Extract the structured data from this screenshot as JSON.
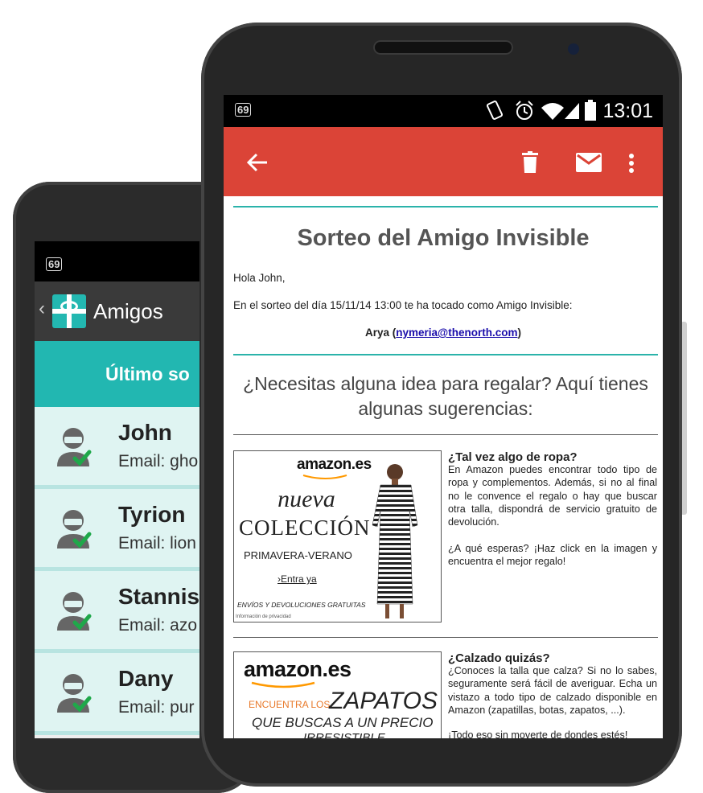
{
  "back_app": {
    "status_badge": "69",
    "title": "Amigos",
    "subtitle": "Último so",
    "contacts": [
      {
        "name": "John",
        "email": "Email: gho"
      },
      {
        "name": "Tyrion",
        "email": "Email: lion"
      },
      {
        "name": "Stannis",
        "email": "Email: azo"
      },
      {
        "name": "Dany",
        "email": "Email: pur"
      }
    ]
  },
  "front_app": {
    "status_badge": "69",
    "time": "13:01",
    "email": {
      "title": "Sorteo del Amigo Invisible",
      "greeting": "Hola John,",
      "intro": "En el sorteo del día 15/11/14 13:00 te ha tocado como Amigo Invisible:",
      "friend_name": "Arya",
      "friend_email": "nymeria@thenorth.com",
      "ideas_heading": "¿Necesitas alguna idea para regalar? Aquí tienes algunas sugerencias:",
      "suggestions": [
        {
          "title": "¿Tal vez algo de ropa?",
          "text": "En Amazon puedes encontrar todo tipo de ropa y complementos. Además, si no al final no le convence el regalo o hay que buscar otra talla, dispondrá de servicio gratuito de devolución.",
          "cta": "¿A qué esperas? ¡Haz click en la imagen y encuentra el mejor regalo!",
          "ad": {
            "brand": "amazon.es",
            "line1": "nueva",
            "line2": "COLECCIÓN",
            "line3": "PRIMAVERA-VERANO",
            "link": "›Entra ya",
            "footer": "ENVÍOS Y DEVOLUCIONES GRATUITAS",
            "privacy": "Información de privacidad"
          }
        },
        {
          "title": "¿Calzado quizás?",
          "text": "¿Conoces la talla que calza? Si no lo sabes, seguramente será fácil de averiguar. Echa un vistazo a todo tipo de calzado disponible en Amazon (zapatillas, botas, zapatos, ...).",
          "cta": "¡Todo eso sin moverte de dondes estés!",
          "ad": {
            "brand": "amazon.es",
            "line1": "ENCUENTRA LOS",
            "line2": "ZAPATOS",
            "line3": "QUE BUSCAS A UN PRECIO",
            "line4": "IRRESISTIBLE"
          }
        }
      ]
    }
  },
  "colors": {
    "app_bar_red": "#db4437",
    "teal": "#22b7b1",
    "contact_bg": "#dff4f2",
    "check_green": "#1fa84a",
    "link_blue": "#1a0dab"
  },
  "icons": [
    "back-arrow-icon",
    "delete-icon",
    "mail-icon",
    "more-vert-icon",
    "gift-icon",
    "person-icon",
    "check-icon",
    "vibrate-icon",
    "alarm-icon",
    "wifi-icon",
    "signal-icon",
    "battery-icon"
  ]
}
